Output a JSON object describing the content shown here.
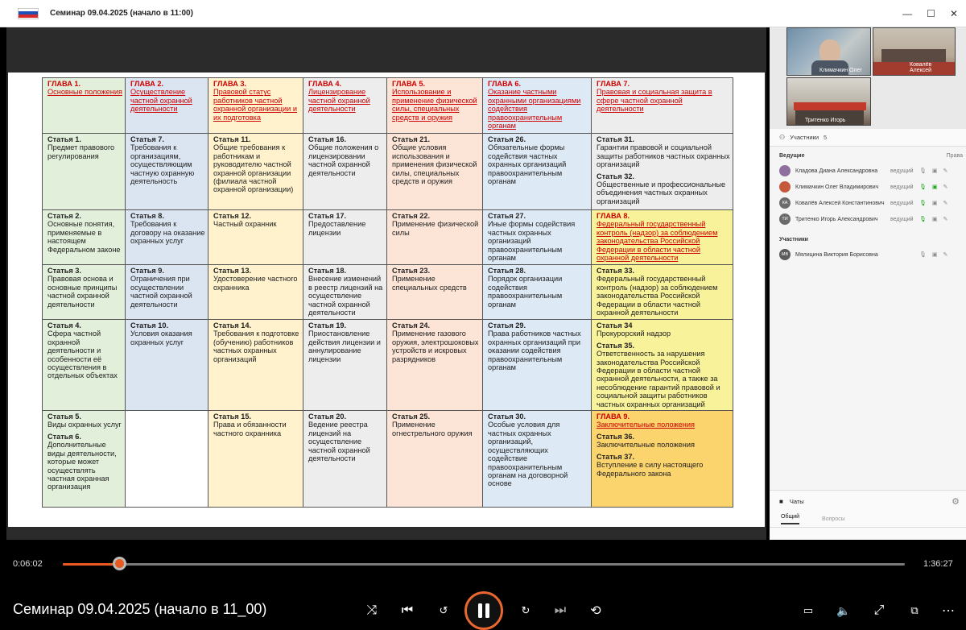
{
  "window": {
    "title": "Семинар 09.04.2025 (начало в 11:00)",
    "controls": [
      "—",
      "☐",
      "✕"
    ]
  },
  "table": {
    "rows": [
      [
        {
          "cls": "c1",
          "lines": [
            [
              "h",
              "ГЛАВА 1."
            ],
            [
              "hu",
              "Основные положения"
            ]
          ]
        },
        {
          "cls": "c2",
          "lines": [
            [
              "h",
              "ГЛАВА 2."
            ],
            [
              "hu",
              "Осуществление частной охранной деятельности"
            ]
          ]
        },
        {
          "cls": "c3",
          "lines": [
            [
              "h",
              "ГЛАВА 3."
            ],
            [
              "hu",
              "Правовой статус работников частной охранной организации и их подготовка"
            ]
          ]
        },
        {
          "cls": "c4",
          "lines": [
            [
              "h",
              "ГЛАВА 4."
            ],
            [
              "hu",
              "Лицензирование частной охранной деятельности"
            ]
          ]
        },
        {
          "cls": "c5",
          "lines": [
            [
              "h",
              "ГЛАВА 5."
            ],
            [
              "hu",
              "Использование и применение физической силы, специальных средств и оружия"
            ]
          ]
        },
        {
          "cls": "c6",
          "lines": [
            [
              "h",
              "ГЛАВА 6."
            ],
            [
              "hu",
              "Оказание частными охранными организациями содействия правоохранительным органам"
            ]
          ]
        },
        {
          "cls": "c7",
          "lines": [
            [
              "h",
              "ГЛАВА 7."
            ],
            [
              "hu",
              "Правовая и социальная защита в сфере частной охранной деятельности"
            ]
          ]
        }
      ],
      [
        {
          "cls": "c1",
          "lines": [
            [
              "sb",
              "Статья 1."
            ],
            [
              "t",
              "Предмет правового регулирования"
            ]
          ]
        },
        {
          "cls": "c2",
          "lines": [
            [
              "sb",
              "Статья 7."
            ],
            [
              "t",
              "Требования к организациям, осуществляющим частную охранную деятельность"
            ]
          ]
        },
        {
          "cls": "c3",
          "lines": [
            [
              "sb",
              "Статья 11."
            ],
            [
              "t",
              "Общие требования к работникам и руководителю частной охранной организации (филиала частной охранной организации)"
            ]
          ]
        },
        {
          "cls": "c4",
          "lines": [
            [
              "sb",
              "Статья 16."
            ],
            [
              "t",
              "Общие положения о лицензировании частной охранной деятельности"
            ]
          ]
        },
        {
          "cls": "c5",
          "lines": [
            [
              "sb",
              "Статья 21."
            ],
            [
              "t",
              "Общие условия использования и применения физической силы, специальных средств и оружия"
            ]
          ]
        },
        {
          "cls": "c6",
          "lines": [
            [
              "sb",
              "Статья 26."
            ],
            [
              "t",
              "Обязательные формы содействия частных охранных организаций правоохранительным органам"
            ]
          ]
        },
        {
          "cls": "c7",
          "lines": [
            [
              "sb",
              "Статья 31."
            ],
            [
              "t",
              "Гарантии правовой и социальной защиты работников частных охранных организаций"
            ],
            [
              "sb",
              "Статья 32."
            ],
            [
              "t",
              "Общественные и профессиональные объединения частных охранных организаций"
            ]
          ]
        }
      ],
      [
        {
          "cls": "c1",
          "lines": [
            [
              "sb",
              "Статья 2."
            ],
            [
              "t",
              "Основные понятия, применяемые в настоящем Федеральном законе"
            ]
          ]
        },
        {
          "cls": "c2",
          "lines": [
            [
              "sb",
              "Статья 8."
            ],
            [
              "t",
              "Требования к договору на оказание охранных услуг"
            ]
          ]
        },
        {
          "cls": "c3",
          "lines": [
            [
              "sb",
              "Статья 12."
            ],
            [
              "t",
              "Частный охранник"
            ]
          ]
        },
        {
          "cls": "c4",
          "lines": [
            [
              "sb",
              "Статья 17."
            ],
            [
              "t",
              "Предоставление лицензии"
            ]
          ]
        },
        {
          "cls": "c5",
          "lines": [
            [
              "sb",
              "Статья 22."
            ],
            [
              "t",
              "Применение физической силы"
            ]
          ]
        },
        {
          "cls": "c6",
          "lines": [
            [
              "sb",
              "Статья 27."
            ],
            [
              "t",
              "Иные формы содействия частных охранных организаций правоохранительным органам"
            ]
          ]
        },
        {
          "cls": "c7y",
          "lines": [
            [
              "h",
              "ГЛАВА 8."
            ],
            [
              "hu",
              "Федеральный государственный контроль (надзор) за соблюдением законодательства Российской Федерации в области частной охранной деятельности"
            ]
          ]
        }
      ],
      [
        {
          "cls": "c1",
          "lines": [
            [
              "sb",
              "Статья 3."
            ],
            [
              "t",
              "Правовая основа и основные принципы частной охранной деятельности"
            ]
          ]
        },
        {
          "cls": "c2",
          "lines": [
            [
              "sb",
              "Статья 9."
            ],
            [
              "t",
              "Ограничения при осуществлении частной охранной деятельности"
            ]
          ]
        },
        {
          "cls": "c3",
          "lines": [
            [
              "sb",
              "Статья 13."
            ],
            [
              "t",
              "Удостоверение частного охранника"
            ]
          ]
        },
        {
          "cls": "c4",
          "lines": [
            [
              "sb",
              "Статья 18."
            ],
            [
              "t",
              "Внесение изменений в реестр лицензий на осуществление частной охранной деятельности"
            ]
          ]
        },
        {
          "cls": "c5",
          "lines": [
            [
              "sb",
              "Статья 23."
            ],
            [
              "t",
              "Применение специальных средств"
            ]
          ]
        },
        {
          "cls": "c6",
          "lines": [
            [
              "sb",
              "Статья 28."
            ],
            [
              "t",
              "Порядок организации содействия правоохранительным органам"
            ]
          ]
        },
        {
          "cls": "c7y",
          "lines": [
            [
              "sb",
              "Статья 33."
            ],
            [
              "t",
              "Федеральный государственный контроль (надзор) за соблюдением законодательства Российской Федерации в области частной охранной деятельности"
            ]
          ]
        }
      ],
      [
        {
          "cls": "c1",
          "lines": [
            [
              "sb",
              "Статья 4."
            ],
            [
              "t",
              "Сфера частной охранной деятельности и особенности её осуществления в отдельных объектах"
            ]
          ]
        },
        {
          "cls": "c2",
          "lines": [
            [
              "sb",
              "Статья 10."
            ],
            [
              "t",
              "Условия оказания охранных услуг"
            ]
          ]
        },
        {
          "cls": "c3",
          "lines": [
            [
              "sb",
              "Статья 14."
            ],
            [
              "t",
              "Требования к подготовке (обучению) работников частных охранных организаций"
            ]
          ]
        },
        {
          "cls": "c4",
          "lines": [
            [
              "sb",
              "Статья 19."
            ],
            [
              "t",
              "Приостановление действия лицензии и аннулирование лицензии"
            ]
          ]
        },
        {
          "cls": "c5",
          "lines": [
            [
              "sb",
              "Статья 24."
            ],
            [
              "t",
              "Применение газового оружия, электрошоковых устройств и искровых разрядников"
            ]
          ]
        },
        {
          "cls": "c6",
          "lines": [
            [
              "sb",
              "Статья 29."
            ],
            [
              "t",
              "Права работников частных охранных организаций при оказании содействия правоохранительным органам"
            ]
          ]
        },
        {
          "cls": "c7y",
          "lines": [
            [
              "sb",
              "Статья 34"
            ],
            [
              "t",
              "Прокурорский надзор"
            ],
            [
              "sb",
              "Статья 35."
            ],
            [
              "t",
              "Ответственность за нарушения законодательства Российской Федерации в области частной охранной деятельности, а также за несоблюдение гарантий правовой и социальной защиты работников частных охранных организаций"
            ]
          ]
        }
      ],
      [
        {
          "cls": "c1",
          "lines": [
            [
              "sb",
              "Статья 5."
            ],
            [
              "t",
              "Виды охранных услуг"
            ],
            [
              "sb",
              "Статья 6."
            ],
            [
              "t",
              "Дополнительные виды деятельности, которые может осуществлять частная охранная организация"
            ]
          ]
        },
        {
          "cls": "cw",
          "lines": []
        },
        {
          "cls": "c3",
          "lines": [
            [
              "sb",
              "Статья 15."
            ],
            [
              "t",
              "Права и обязанности частного охранника"
            ]
          ]
        },
        {
          "cls": "c4",
          "lines": [
            [
              "sb",
              "Статья 20."
            ],
            [
              "t",
              "Ведение реестра лицензий на осуществление частной охранной деятельности"
            ]
          ]
        },
        {
          "cls": "c5",
          "lines": [
            [
              "sb",
              "Статья 25."
            ],
            [
              "t",
              "Применение огнестрельного оружия"
            ]
          ]
        },
        {
          "cls": "c6",
          "lines": [
            [
              "sb",
              "Статья 30."
            ],
            [
              "t",
              "Особые условия для частных охранных организаций, осуществляющих содействие правоохранительным органам на договорной основе"
            ]
          ]
        },
        {
          "cls": "c7o",
          "lines": [
            [
              "h",
              "ГЛАВА 9."
            ],
            [
              "hu",
              "Заключительные положения"
            ],
            [
              "sb",
              "Статья 36."
            ],
            [
              "t",
              "Заключительные положения"
            ],
            [
              "sb",
              "Статья 37."
            ],
            [
              "t",
              "Вступление в силу настоящего Федерального закона"
            ]
          ]
        }
      ]
    ]
  },
  "videos": [
    {
      "name": "Климачкин Олег"
    },
    {
      "name": "Ковалёв Алексей"
    },
    {
      "name": "Тритенко Игорь"
    }
  ],
  "participants": {
    "header": "Участники",
    "count": "5",
    "hosts_label": "Ведущие",
    "rights_label": "Права",
    "members_label": "Участники",
    "hosts": [
      {
        "initials": "",
        "name": "Кладова Диана Александровна",
        "role": "ведущий",
        "color": "#8e6f9d"
      },
      {
        "initials": "",
        "name": "Климачкин Олег Владимирович",
        "role": "ведущий",
        "color": "#c45a3b"
      },
      {
        "initials": "КА",
        "name": "Ковалёв Алексей Константинович",
        "role": "ведущий",
        "color": "#6b6b6b"
      },
      {
        "initials": "ТИ",
        "name": "Тритенко Игорь Александрович",
        "role": "ведущий",
        "color": "#6b6b6b"
      }
    ],
    "members": [
      {
        "initials": "МВ",
        "name": "Мялицина Виктория Борисовна",
        "role": "",
        "color": "#5c5c5c"
      }
    ]
  },
  "chat": {
    "title": "Чаты",
    "tabs": [
      "Общий",
      "Вопросы"
    ]
  },
  "player": {
    "elapsed": "0:06:02",
    "duration": "1:36:27",
    "progress": 0.068,
    "title": "Семинар 09.04.2025 (начало в 11_00)",
    "accent": "#e85a1e"
  }
}
